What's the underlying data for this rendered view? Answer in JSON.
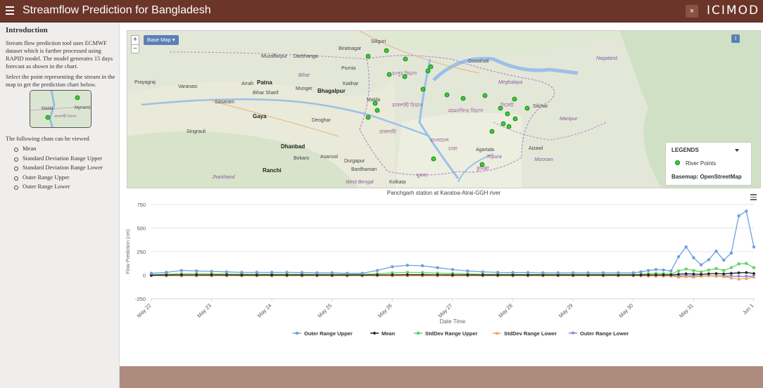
{
  "header": {
    "title": "Streamflow Prediction for Bangladesh",
    "close_label": "×",
    "logo": "ICIMOD"
  },
  "sidebar": {
    "heading": "Introduction",
    "intro": "Stream flow prediction tool uses ECMWF dataset which is further processed using RAPID model. The model generates 15 days forecast as shown in the chart.",
    "instruction": "Select the point representing the stream in the map to get the prediction chart below.",
    "thumb_labels": [
      "Malda",
      "Mymens",
      "রাজশাহী বিভাগ"
    ],
    "charts_intro": "The following chats can be viewed",
    "charts": [
      "Mean",
      "Standard Deviation Range Upper",
      "Standard Deviation Range Lower",
      "Outer Range Upper",
      "Outer Range Lower"
    ]
  },
  "map": {
    "zoom_in": "+",
    "zoom_out": "−",
    "basemap_button": "Base Map",
    "info_button": "i",
    "legend": {
      "title": "LEGENDS",
      "item": "River Points",
      "basemap": "Basemap: OpenStreetMap"
    },
    "labels": [
      {
        "t": "Siliguri",
        "c": ""
      },
      {
        "t": "Biratnagar",
        "c": ""
      },
      {
        "t": "Muzaffarpur",
        "c": ""
      },
      {
        "t": "Darbhanga",
        "c": ""
      },
      {
        "t": "Bihar",
        "c": "reg"
      },
      {
        "t": "Purnia",
        "c": ""
      },
      {
        "t": "Katihar",
        "c": ""
      },
      {
        "t": "Guwahati",
        "c": ""
      },
      {
        "t": "Prayagraj",
        "c": ""
      },
      {
        "t": "Varanasi",
        "c": ""
      },
      {
        "t": "Arrah",
        "c": ""
      },
      {
        "t": "Patna",
        "c": "cap"
      },
      {
        "t": "Bihar Sharif",
        "c": ""
      },
      {
        "t": "Munger",
        "c": ""
      },
      {
        "t": "Bhagalpur",
        "c": "cap"
      },
      {
        "t": "Meghalaya",
        "c": "reg"
      },
      {
        "t": "Sasaram",
        "c": ""
      },
      {
        "t": "Gaya",
        "c": "cap"
      },
      {
        "t": "Malda",
        "c": ""
      },
      {
        "t": "Silchar",
        "c": ""
      },
      {
        "t": "Manipur",
        "c": "reg"
      },
      {
        "t": "Singrauli",
        "c": ""
      },
      {
        "t": "Deoghar",
        "c": ""
      },
      {
        "t": "রাজশাহী",
        "c": "bn"
      },
      {
        "t": "Dhanbad",
        "c": "cap"
      },
      {
        "t": "Bokaro",
        "c": ""
      },
      {
        "t": "Asansol",
        "c": ""
      },
      {
        "t": "Durgapur",
        "c": ""
      },
      {
        "t": "Agartala",
        "c": ""
      },
      {
        "t": "Aizawl",
        "c": ""
      },
      {
        "t": "Ranchi",
        "c": "cap"
      },
      {
        "t": "Bardhaman",
        "c": ""
      },
      {
        "t": "West Bengal",
        "c": "reg"
      },
      {
        "t": "Tripura",
        "c": "reg"
      },
      {
        "t": "Mizoram",
        "c": "reg"
      },
      {
        "t": "Nagaland",
        "c": "reg"
      },
      {
        "t": "রংপুর বিভাগ",
        "c": "bn"
      },
      {
        "t": "রাজশাহী বিভাগ",
        "c": "bn"
      },
      {
        "t": "বাংলাদেশ",
        "c": "bn"
      },
      {
        "t": "ময়মনসিংহ বিভাগ",
        "c": "bn"
      },
      {
        "t": "সিলেট",
        "c": "bn"
      },
      {
        "t": "ঢাকা",
        "c": "bn"
      },
      {
        "t": "কুমিল্লা",
        "c": "bn"
      },
      {
        "t": "খুলনা",
        "c": "bn"
      },
      {
        "t": "Jharkhand",
        "c": "reg"
      },
      {
        "t": "Kolkata",
        "c": ""
      }
    ]
  },
  "chart": {
    "menu": "≡",
    "chart_data": {
      "type": "line",
      "title": "Panchgarh station at Karatoa-Atrai-GGH river",
      "xlabel": "Date Time",
      "ylabel": "Flow Prediction (cm)",
      "ylim": [
        -250,
        750
      ],
      "yticks": [
        -250,
        0,
        250,
        500,
        750
      ],
      "xticks": [
        "May 22",
        "May 23",
        "May 24",
        "May 25",
        "May 26",
        "May 27",
        "May 28",
        "May 29",
        "May 30",
        "May 31",
        "Jun 1"
      ],
      "x_days_range": [
        0,
        10
      ],
      "x": [
        0,
        0.25,
        0.5,
        0.75,
        1,
        1.25,
        1.5,
        1.75,
        2,
        2.25,
        2.5,
        2.75,
        3,
        3.25,
        3.5,
        3.75,
        4,
        4.25,
        4.5,
        4.75,
        5,
        5.25,
        5.5,
        5.75,
        6,
        6.25,
        6.5,
        6.75,
        7,
        7.25,
        7.5,
        7.75,
        8,
        8.125,
        8.25,
        8.375,
        8.5,
        8.625,
        8.75,
        8.875,
        9,
        9.125,
        9.25,
        9.375,
        9.5,
        9.625,
        9.75,
        9.875,
        10
      ],
      "series": [
        {
          "name": "Outer Range Upper",
          "color": "#6fa0dc",
          "marker": "circle",
          "values": [
            20,
            30,
            50,
            45,
            40,
            35,
            30,
            30,
            30,
            30,
            28,
            25,
            25,
            20,
            20,
            50,
            90,
            105,
            100,
            80,
            60,
            45,
            35,
            30,
            28,
            28,
            25,
            25,
            25,
            25,
            25,
            25,
            25,
            35,
            50,
            60,
            55,
            45,
            195,
            300,
            185,
            110,
            165,
            255,
            160,
            235,
            630,
            680,
            300
          ]
        },
        {
          "name": "Mean",
          "color": "#222222",
          "marker": "diamond",
          "values": [
            0,
            2,
            3,
            3,
            3,
            3,
            2,
            2,
            2,
            2,
            2,
            2,
            2,
            2,
            2,
            3,
            4,
            5,
            5,
            4,
            3,
            3,
            2,
            2,
            2,
            2,
            2,
            2,
            2,
            2,
            2,
            2,
            2,
            2,
            3,
            3,
            3,
            3,
            10,
            15,
            12,
            8,
            15,
            18,
            14,
            20,
            25,
            28,
            18
          ]
        },
        {
          "name": "StdDev Range Upper",
          "color": "#66d46a",
          "marker": "square",
          "values": [
            5,
            10,
            15,
            15,
            13,
            12,
            10,
            10,
            10,
            10,
            9,
            8,
            8,
            8,
            8,
            15,
            25,
            30,
            28,
            22,
            18,
            13,
            10,
            10,
            8,
            8,
            8,
            8,
            8,
            8,
            8,
            8,
            8,
            10,
            15,
            18,
            16,
            12,
            45,
            65,
            50,
            35,
            55,
            70,
            50,
            80,
            120,
            125,
            80
          ]
        },
        {
          "name": "StdDev Range Lower",
          "color": "#f6a05a",
          "marker": "triangle",
          "values": [
            -3,
            -5,
            -5,
            -5,
            -5,
            -5,
            -5,
            -5,
            -5,
            -5,
            -5,
            -5,
            -5,
            -5,
            -5,
            -5,
            -6,
            -6,
            -6,
            -5,
            -5,
            -5,
            -5,
            -5,
            -5,
            -5,
            -5,
            -5,
            -5,
            -5,
            -5,
            -5,
            -5,
            -5,
            -8,
            -8,
            -8,
            -8,
            -20,
            -15,
            -20,
            -10,
            -5,
            -10,
            -15,
            -30,
            -40,
            -35,
            -20
          ]
        },
        {
          "name": "Outer Range Lower",
          "color": "#8085e9",
          "marker": "triangle-down",
          "values": [
            -5,
            -5,
            -5,
            -5,
            -5,
            -5,
            -5,
            -5,
            -5,
            -5,
            -5,
            -5,
            -5,
            -5,
            -5,
            -5,
            -5,
            -5,
            -5,
            -5,
            -5,
            -5,
            -5,
            -5,
            -5,
            -5,
            -5,
            -5,
            -5,
            -5,
            -5,
            -5,
            -5,
            -5,
            -5,
            -5,
            -5,
            -5,
            -10,
            -10,
            -10,
            -8,
            -8,
            -8,
            -10,
            -12,
            -15,
            -15,
            -12
          ]
        }
      ],
      "legend_position": "bottom"
    }
  }
}
